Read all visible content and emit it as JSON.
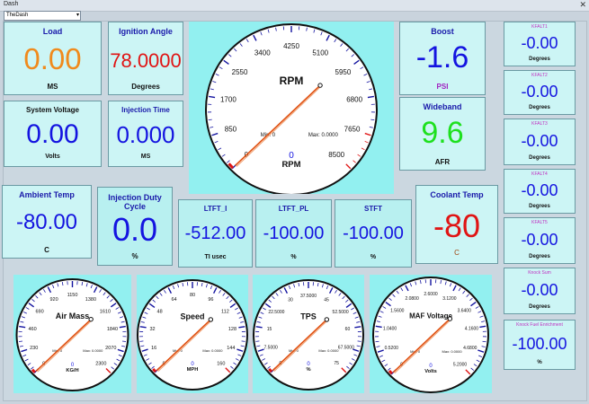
{
  "window": {
    "title": "Dash"
  },
  "dash_select": {
    "value": "TheDash"
  },
  "tiles": {
    "load": {
      "label": "Load",
      "value": "0.00",
      "unit": "MS"
    },
    "ignition": {
      "label": "Ignition Angle",
      "value": "78.0000",
      "unit": "Degrees"
    },
    "sysvolt": {
      "label": "System Voltage",
      "value": "0.00",
      "unit": "Volts"
    },
    "injtime": {
      "label": "Injection Time",
      "value": "0.000",
      "unit": "MS"
    },
    "boost": {
      "label": "Boost",
      "value": "-1.6",
      "unit": "PSI"
    },
    "wideband": {
      "label": "Wideband",
      "value": "9.6",
      "unit": "AFR"
    },
    "ambient": {
      "label": "Ambient Temp",
      "value": "-80.00",
      "unit": "C"
    },
    "injduty": {
      "label": "Injection Duty Cycle",
      "value": "0.0",
      "unit": "%"
    },
    "ltft_i": {
      "label": "LTFT_I",
      "value": "-512.00",
      "unit": "TI usec"
    },
    "ltft_pl": {
      "label": "LTFT_PL",
      "value": "-100.00",
      "unit": "%"
    },
    "stft": {
      "label": "STFT",
      "value": "-100.00",
      "unit": "%"
    },
    "coolant": {
      "label": "Coolant Temp",
      "value": "-80",
      "unit": "C"
    }
  },
  "small_tiles": [
    {
      "label": "KFALT1",
      "value": "-0.00",
      "unit": "Degrees"
    },
    {
      "label": "KFALT2",
      "value": "-0.00",
      "unit": "Degrees"
    },
    {
      "label": "KFALT3",
      "value": "-0.00",
      "unit": "Degrees"
    },
    {
      "label": "KFALT4",
      "value": "-0.00",
      "unit": "Degrees"
    },
    {
      "label": "KFALT5",
      "value": "-0.00",
      "unit": "Degrees"
    },
    {
      "label": "Knock Sum",
      "value": "-0.00",
      "unit": "Degrees"
    },
    {
      "label": "Knock Fuel Enrichment",
      "value": "-100.00",
      "unit": "%"
    }
  ],
  "gauges": {
    "rpm": {
      "title": "RPM",
      "unit": "RPM",
      "value": "0",
      "min_text": "Min: 0",
      "max_text": "Max: 0.0000",
      "ticks": [
        "0",
        "850",
        "1700",
        "2550",
        "3400",
        "4250",
        "5100",
        "5950",
        "6800",
        "7650",
        "8500"
      ],
      "min": 0,
      "max": 8500,
      "current": 0,
      "peak": 0,
      "red_from": 0.9
    },
    "airmass": {
      "title": "Air Mass",
      "unit": "KG/H",
      "value": "0",
      "min_text": "Min: 0",
      "max_text": "Max: 0.0000",
      "ticks": [
        "0",
        "230",
        "460",
        "690",
        "920",
        "1150",
        "1380",
        "1610",
        "1840",
        "2070",
        "2300"
      ],
      "min": 0,
      "max": 2300,
      "current": 0,
      "peak": 0,
      "red_from": 1
    },
    "speed": {
      "title": "Speed",
      "unit": "MPH",
      "value": "0",
      "min_text": "Min: 0",
      "max_text": "Max: 0.0000",
      "ticks": [
        "0",
        "16",
        "32",
        "48",
        "64",
        "80",
        "96",
        "112",
        "128",
        "144",
        "160"
      ],
      "min": 0,
      "max": 160,
      "current": 0,
      "peak": 0,
      "red_from": 1
    },
    "tps": {
      "title": "TPS",
      "unit": "%",
      "value": "0",
      "min_text": "Min: 0",
      "max_text": "Max: 0.0000",
      "ticks": [
        "0",
        "7.5000",
        "15",
        "22.5000",
        "30",
        "37.5000",
        "45",
        "52.5000",
        "60",
        "67.5000",
        "75"
      ],
      "min": 0,
      "max": 75,
      "current": 0,
      "peak": 0,
      "red_from": 1
    },
    "maf": {
      "title": "MAF Voltage",
      "unit": "Volts",
      "value": "0",
      "min_text": "Min: 0",
      "max_text": "Max: 0.0000",
      "ticks": [
        "0",
        "0.5200",
        "1.0400",
        "1.5600",
        "2.0800",
        "2.6000",
        "3.1200",
        "3.6400",
        "4.1600",
        "4.6800",
        "5.2000"
      ],
      "min": 0,
      "max": 5.2,
      "current": 0,
      "peak": 0,
      "red_from": 1
    }
  },
  "colors": {
    "orange": "#f08a1c",
    "red": "#e01414",
    "blue": "#1414e0",
    "green": "#1ee01e",
    "purple": "#a020c0",
    "tile_bg": "#ccf5f5",
    "gauge_bg": "#92f0f0"
  }
}
